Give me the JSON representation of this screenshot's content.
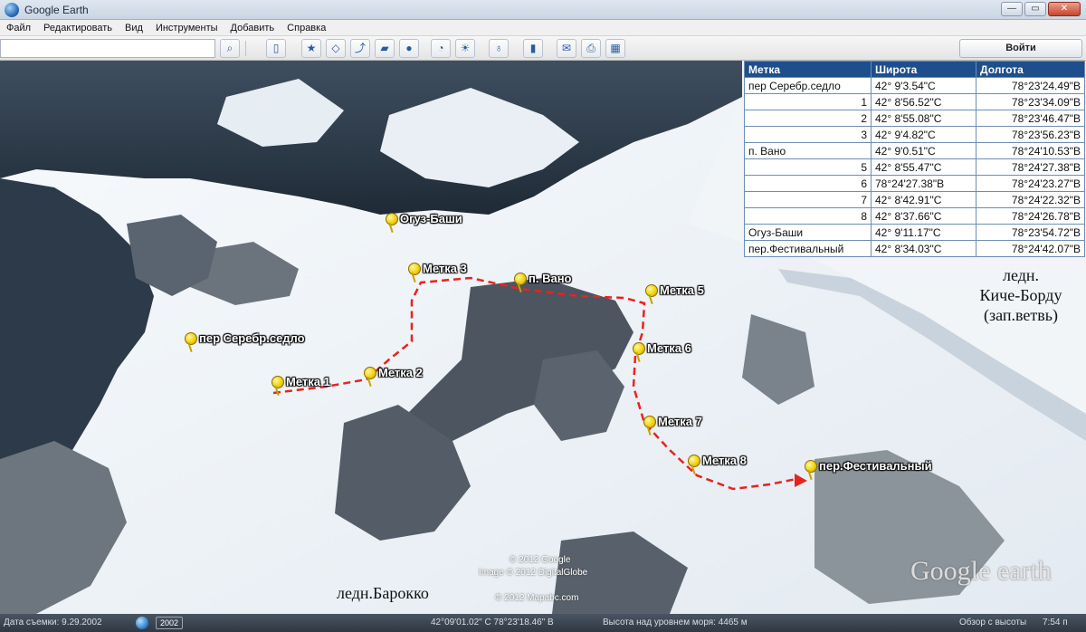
{
  "window": {
    "title": "Google Earth",
    "buttons": {
      "minimize": "—",
      "maximize": "▭",
      "close": "✕"
    }
  },
  "menu": [
    "Файл",
    "Редактировать",
    "Вид",
    "Инструменты",
    "Добавить",
    "Справка"
  ],
  "toolbar": {
    "search_value": "",
    "signin_label": "Войти",
    "icons": [
      "search-icon",
      "sidebar-icon",
      "placemark-icon",
      "polygon-icon",
      "path-icon",
      "image-overlay-icon",
      "record-tour-icon",
      "historical-imagery-icon",
      "sun-icon",
      "planets-icon",
      "ruler-icon",
      "email-icon",
      "print-icon",
      "view-in-maps-icon"
    ]
  },
  "table": {
    "headers": {
      "name": "Метка",
      "lat": "Широта",
      "lon": "Долгота"
    },
    "rows": [
      {
        "name": "пер Серебр.седло",
        "lat": "42° 9'3.54\"С",
        "lon": "78°23'24.49\"В"
      },
      {
        "name": "1",
        "lat": "42° 8'56.52\"С",
        "lon": "78°23'34.09\"В"
      },
      {
        "name": "2",
        "lat": "42° 8'55.08\"С",
        "lon": "78°23'46.47\"В"
      },
      {
        "name": "3",
        "lat": "42° 9'4.82\"С",
        "lon": "78°23'56.23\"В"
      },
      {
        "name": "п. Вано",
        "lat": "42° 9'0.51\"С",
        "lon": "78°24'10.53\"В"
      },
      {
        "name": "5",
        "lat": "42° 8'55.47\"С",
        "lon": "78°24'27.38\"В"
      },
      {
        "name": "6",
        "lat": "78°24'27.38\"В",
        "lon": "78°24'23.27\"В"
      },
      {
        "name": "7",
        "lat": "42° 8'42.91\"С",
        "lon": "78°24'22.32\"В"
      },
      {
        "name": "8",
        "lat": "42° 8'37.66\"С",
        "lon": "78°24'26.78\"В"
      },
      {
        "name": "Огуз-Баши",
        "lat": "42° 9'11.17\"С",
        "lon": "78°23'54.72\"В"
      },
      {
        "name": "пер.Фестивальный",
        "lat": "42° 8'34.03\"С",
        "lon": "78°24'42.07\"В"
      }
    ]
  },
  "placemarks": {
    "oguz": "Огуз-Баши",
    "m3": "Метка 3",
    "vano": "п. Вано",
    "m5": "Метка 5",
    "serebr": "пер Серебр.седло",
    "m6": "Метка 6",
    "m1": "Метка 1",
    "m2": "Метка 2",
    "m7": "Метка 7",
    "m8": "Метка 8",
    "festival": "пер.Фестивальный"
  },
  "map_labels": {
    "kiche_line1": "ледн.",
    "kiche_line2": "Киче-Борду",
    "kiche_line3": "(зап.ветвь)",
    "barokko": "ледн.Барокко"
  },
  "copyright": {
    "line1": "© 2012 Google",
    "line2": "Image © 2012 DigitalGlobe",
    "line3": "© 2012 Mapabc.com",
    "logo": "Google earth"
  },
  "status": {
    "date": "Дата съемки: 9.29.2002",
    "year": "2002",
    "coords": "42°09'01.02\" С  78°23'18.46\" В",
    "elevation": "Высота над уровнем моря:  4465 м",
    "eye": "Обзор с высоты",
    "time": "7:54 п"
  },
  "colors": {
    "route": "#e8231e",
    "table_header": "#1f4e8c",
    "pin": "#f0cf00"
  }
}
